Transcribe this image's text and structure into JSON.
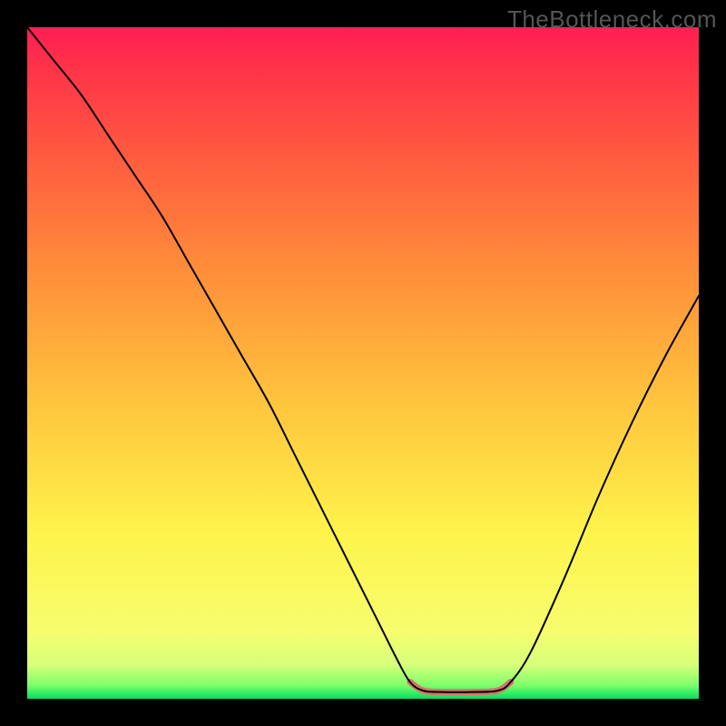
{
  "watermark": "TheBottleneck.com",
  "chart_data": {
    "type": "line",
    "title": "",
    "xlabel": "",
    "ylabel": "",
    "xlim": [
      0,
      100
    ],
    "ylim": [
      0,
      100
    ],
    "grid": false,
    "curve_points": [
      {
        "x": 0,
        "y": 100
      },
      {
        "x": 4,
        "y": 95
      },
      {
        "x": 8,
        "y": 90
      },
      {
        "x": 12,
        "y": 84
      },
      {
        "x": 16,
        "y": 78
      },
      {
        "x": 20,
        "y": 72
      },
      {
        "x": 24,
        "y": 65
      },
      {
        "x": 28,
        "y": 58
      },
      {
        "x": 32,
        "y": 51
      },
      {
        "x": 36,
        "y": 44
      },
      {
        "x": 40,
        "y": 36
      },
      {
        "x": 44,
        "y": 28
      },
      {
        "x": 48,
        "y": 20
      },
      {
        "x": 52,
        "y": 12
      },
      {
        "x": 55,
        "y": 6
      },
      {
        "x": 57,
        "y": 2.5
      },
      {
        "x": 59,
        "y": 1.2
      },
      {
        "x": 62,
        "y": 1.0
      },
      {
        "x": 66,
        "y": 1.0
      },
      {
        "x": 70,
        "y": 1.2
      },
      {
        "x": 72,
        "y": 2.5
      },
      {
        "x": 75,
        "y": 7
      },
      {
        "x": 80,
        "y": 18
      },
      {
        "x": 85,
        "y": 30
      },
      {
        "x": 90,
        "y": 41
      },
      {
        "x": 95,
        "y": 51
      },
      {
        "x": 100,
        "y": 60
      }
    ],
    "base_knots": [
      {
        "x": 57,
        "y": 2.5
      },
      {
        "x": 59,
        "y": 1.2
      },
      {
        "x": 62,
        "y": 1.0
      },
      {
        "x": 66,
        "y": 1.0
      },
      {
        "x": 70,
        "y": 1.2
      },
      {
        "x": 72,
        "y": 2.5
      }
    ],
    "gradient_stops": [
      {
        "offset": 0.0,
        "color": "#00e060"
      },
      {
        "offset": 0.02,
        "color": "#7dff6a"
      },
      {
        "offset": 0.05,
        "color": "#d6ff7a"
      },
      {
        "offset": 0.1,
        "color": "#f7fd6e"
      },
      {
        "offset": 0.25,
        "color": "#fef34a"
      },
      {
        "offset": 0.45,
        "color": "#ffc23d"
      },
      {
        "offset": 0.65,
        "color": "#ff8a3a"
      },
      {
        "offset": 0.82,
        "color": "#ff5740"
      },
      {
        "offset": 0.95,
        "color": "#ff2f4a"
      },
      {
        "offset": 1.0,
        "color": "#ff1e55"
      }
    ],
    "curve_stroke": "#000000",
    "curve_stroke_width": 2,
    "base_segment_stroke": "#d8746c",
    "base_segment_stroke_width": 7
  }
}
